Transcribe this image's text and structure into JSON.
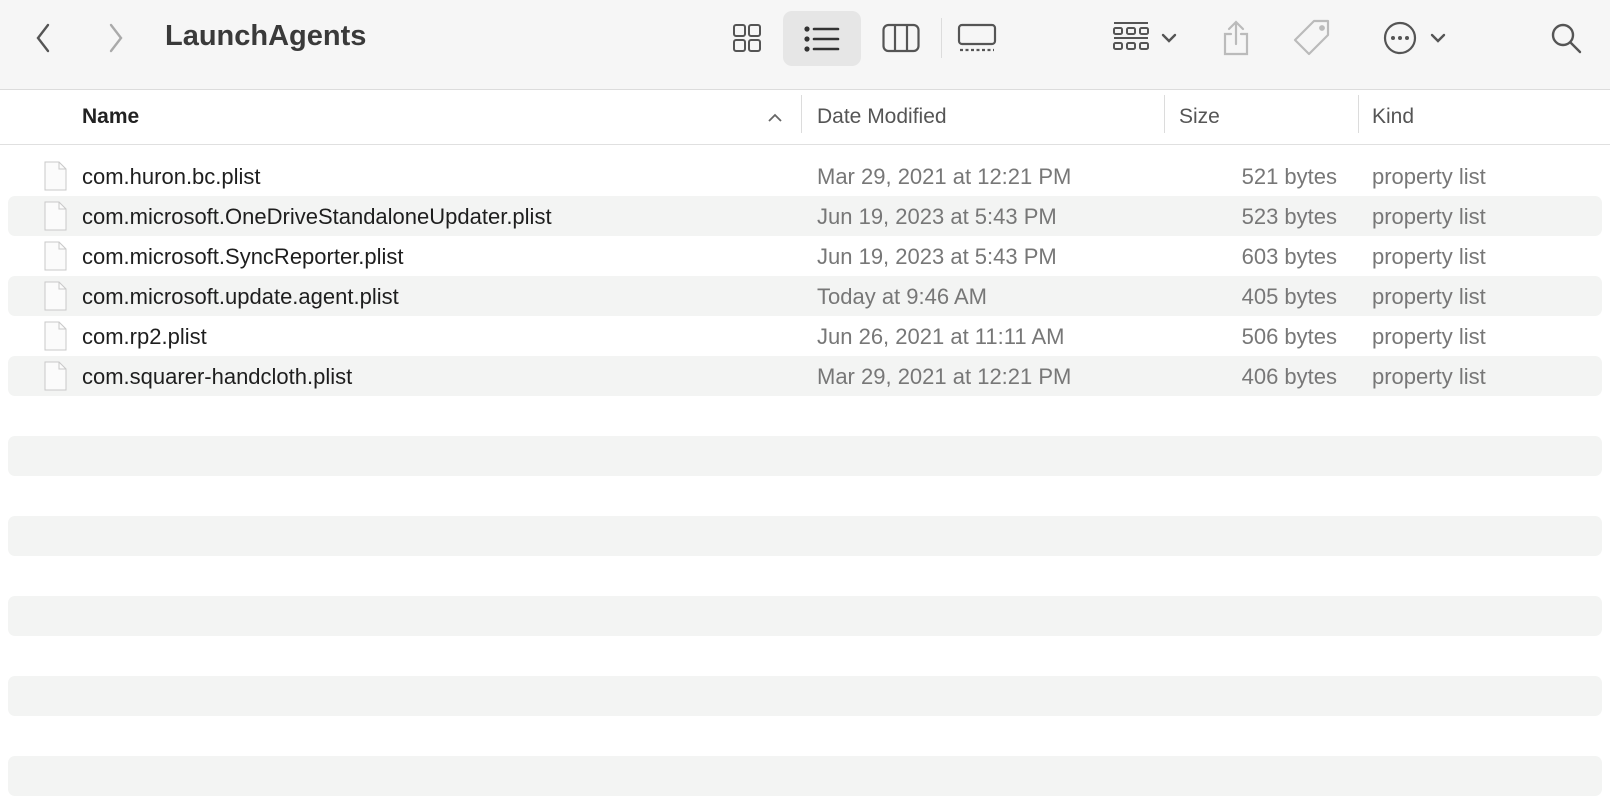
{
  "toolbar": {
    "title": "LaunchAgents"
  },
  "columns": {
    "name": "Name",
    "date": "Date Modified",
    "size": "Size",
    "kind": "Kind"
  },
  "files": [
    {
      "name": "com.huron.bc.plist",
      "date": "Mar 29, 2021 at 12:21 PM",
      "size": "521 bytes",
      "kind": "property list"
    },
    {
      "name": "com.microsoft.OneDriveStandaloneUpdater.plist",
      "date": "Jun 19, 2023 at 5:43 PM",
      "size": "523 bytes",
      "kind": "property list"
    },
    {
      "name": "com.microsoft.SyncReporter.plist",
      "date": "Jun 19, 2023 at 5:43 PM",
      "size": "603 bytes",
      "kind": "property list"
    },
    {
      "name": "com.microsoft.update.agent.plist",
      "date": "Today at 9:46 AM",
      "size": "405 bytes",
      "kind": "property list"
    },
    {
      "name": "com.rp2.plist",
      "date": "Jun 26, 2021 at 11:11 AM",
      "size": "506 bytes",
      "kind": "property list"
    },
    {
      "name": "com.squarer-handcloth.plist",
      "date": "Mar 29, 2021 at 12:21 PM",
      "size": "406 bytes",
      "kind": "property list"
    }
  ]
}
